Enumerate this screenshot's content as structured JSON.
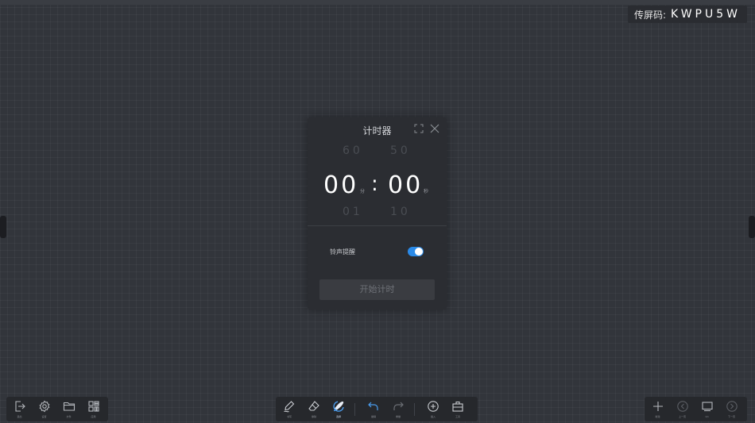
{
  "top": {
    "strip_text": "",
    "screen_code_label": "传屏码:",
    "screen_code": "KWPU5W"
  },
  "timer": {
    "title": "计时器",
    "minutes_prev": "60",
    "seconds_prev": "50",
    "minutes": "00",
    "seconds": "00",
    "minutes_unit": "分",
    "seconds_unit": "秒",
    "colon": ":",
    "minutes_next": "01",
    "seconds_next": "10",
    "bell_label": "铃声提醒",
    "bell_enabled": true,
    "start_label": "开始计时",
    "accent": "#2a8ae8"
  },
  "toolbar_left": {
    "items": [
      {
        "icon": "exit-icon",
        "label": "退出"
      },
      {
        "icon": "gear-icon",
        "label": "设置"
      },
      {
        "icon": "folder-icon",
        "label": "文件"
      },
      {
        "icon": "apps-icon",
        "label": "应用"
      }
    ]
  },
  "toolbar_center": {
    "items": [
      {
        "icon": "pen-icon",
        "label": "书写"
      },
      {
        "icon": "eraser-icon",
        "label": "擦除"
      },
      {
        "icon": "select-icon",
        "label": "选择",
        "active": true
      },
      {
        "icon": "undo-icon",
        "label": "撤销"
      },
      {
        "icon": "redo-icon",
        "label": "重做"
      },
      {
        "icon": "insert-icon",
        "label": "插入"
      },
      {
        "icon": "toolbox-icon",
        "label": "工具"
      }
    ]
  },
  "toolbar_right": {
    "items": [
      {
        "icon": "plus-icon",
        "label": "新建"
      },
      {
        "icon": "prev-icon",
        "label": "上一页"
      },
      {
        "icon": "pages-icon",
        "label": "1/1"
      },
      {
        "icon": "next-icon",
        "label": "下一页"
      }
    ]
  }
}
